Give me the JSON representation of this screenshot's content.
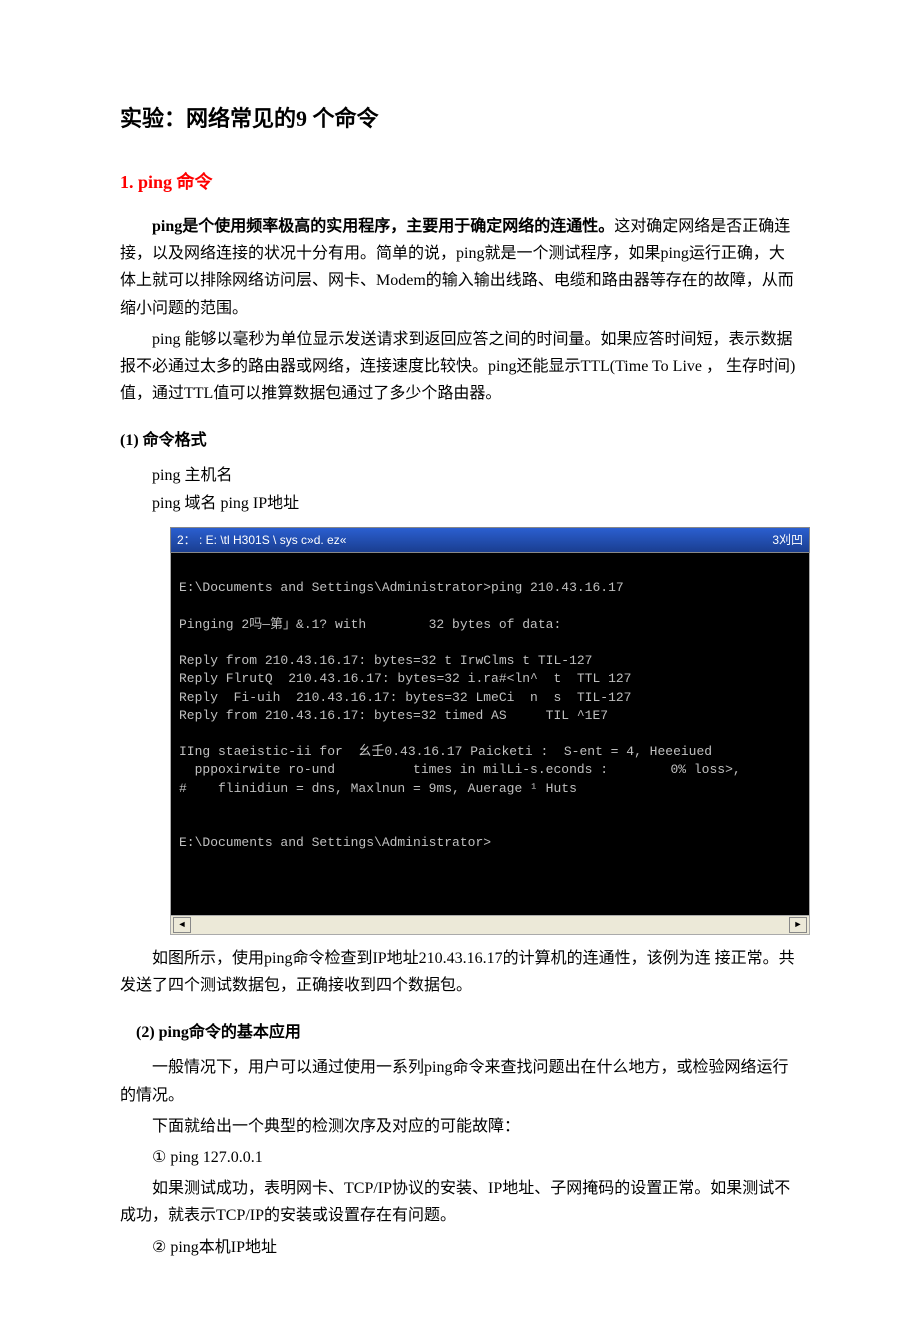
{
  "title": "实验：网络常见的9 个命令",
  "section1": {
    "heading": "1. ping 命令",
    "p1_bold": "ping是个使用频率极高的实用程序，主要用于确定网络的连通性。",
    "p1_rest": "这对确定网络是否正确连接，以及网络连接的状况十分有用。简单的说，ping就是一个测试程序，如果ping运行正确，大体上就可以排除网络访问层、网卡、Modem的输入输出线路、电缆和路由器等存在的故障，从而缩小问题的范围。",
    "p2": "ping 能够以毫秒为单位显示发送请求到返回应答之间的时间量。如果应答时间短，表示数据报不必通过太多的路由器或网络，连接速度比较快。ping还能显示TTL(Time To Live ，  生存时间)值，通过TTL值可以推算数据包通过了多少个路由器。",
    "sub1": {
      "heading": "(1)  命令格式",
      "line1": "ping    主机名",
      "line2": "ping 域名 ping IP地址"
    },
    "terminal": {
      "title_left": "2： :   E: \\tl H301S \\ sys          c»d. ez«",
      "title_right": "3刈凹",
      "lines": [
        "",
        "E:\\Documents and Settings\\Administrator>ping 210.43.16.17",
        "",
        "Pinging 2吗—第」&.1? with        32 bytes of data:",
        "",
        "Reply from 210.43.16.17: bytes=32 t IrwClms t TIL-127",
        "Reply FlrutQ  210.43.16.17: bytes=32 i.ra#<ln^  t  TTL 127",
        "Reply  Fi-uih  210.43.16.17: bytes=32 LmeCi  n  s  TIL-127",
        "Reply from 210.43.16.17: bytes=32 timed AS     TIL ^1E7",
        "",
        "IIng staeistic-ii for  幺壬0.43.16.17 Paicketi :  S-ent = 4, Heeeiued",
        "  pppoxirwite ro-und          times in milLi-s.econds :        0% loss>,",
        "#    flinidiun = dns, Maxlnun = 9ms, Auerage ¹ Huts",
        "",
        "",
        "E:\\Documents and Settings\\Administrator>",
        "",
        "",
        "",
        ""
      ]
    },
    "after_img": "如图所示，使用ping命令检查到IP地址210.43.16.17的计算机的连通性，该例为连 接正常。共发送了四个测试数据包，正确接收到四个数据包。",
    "sub2": {
      "heading": "(2) ping命令的基本应用",
      "p1": "一般情况下，用户可以通过使用一系列ping命令来查找问题出在什么地方，或检验网络运行的情况。",
      "p2": "下面就给出一个典型的检测次序及对应的可能故障：",
      "item1": "① ping 127.0.0.1",
      "item1_detail": "如果测试成功，表明网卡、TCP/IP协议的安装、IP地址、子网掩码的设置正常。如果测试不成功，就表示TCP/IP的安装或设置存在有问题。",
      "item2": "② ping本机IP地址"
    }
  }
}
